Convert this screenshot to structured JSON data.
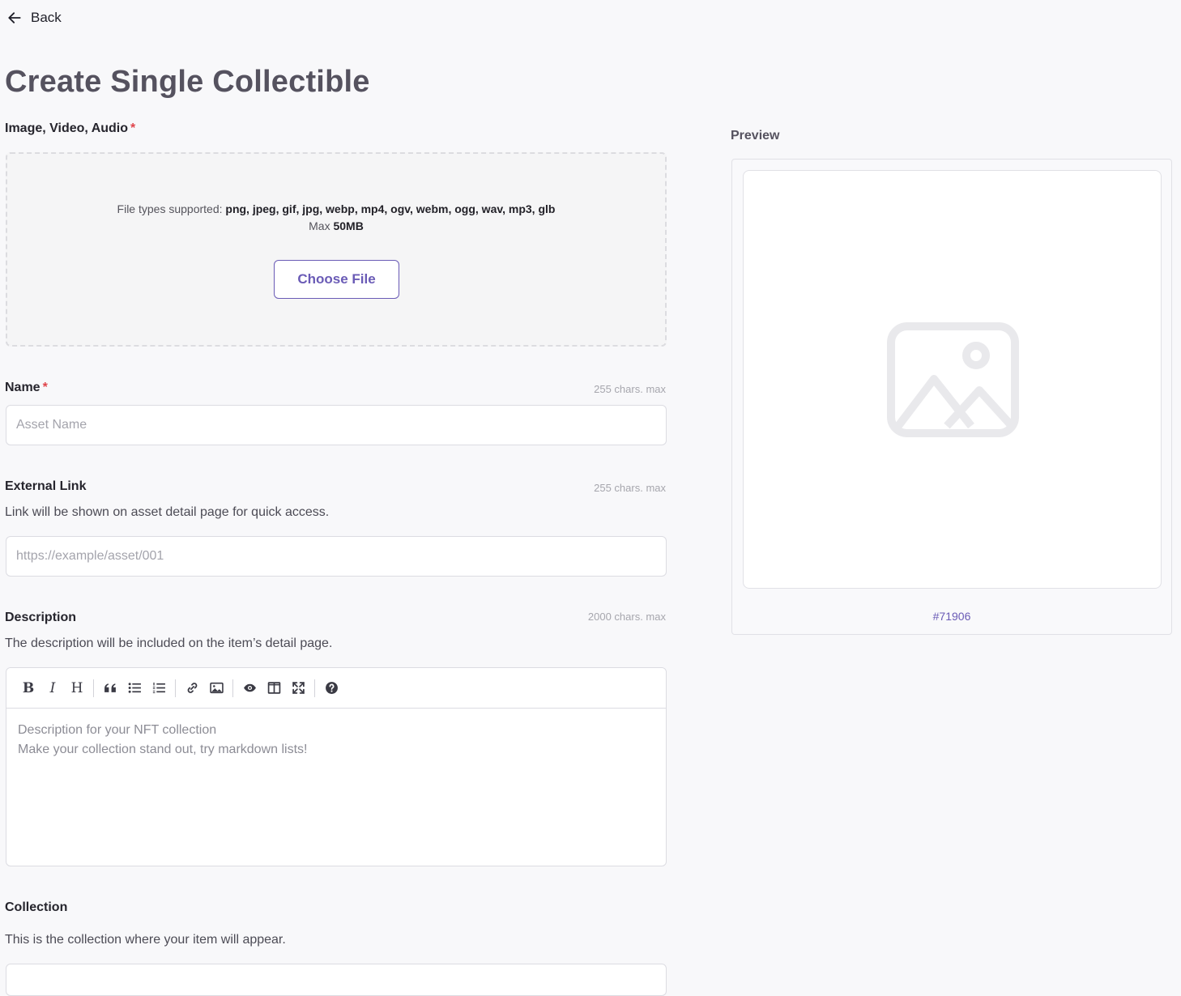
{
  "nav": {
    "back_label": "Back"
  },
  "page_title": "Create Single Collectible",
  "upload": {
    "label": "Image, Video, Audio",
    "required_mark": "*",
    "types_prefix": "File types supported: ",
    "types": "png, jpeg, gif, jpg, webp, mp4, ogv, webm, ogg, wav, mp3, glb",
    "max_prefix": "Max ",
    "max_size": "50MB",
    "choose_label": "Choose File"
  },
  "name": {
    "label": "Name",
    "required_mark": "*",
    "limit": "255 chars. max",
    "placeholder": "Asset Name",
    "value": ""
  },
  "external_link": {
    "label": "External Link",
    "limit": "255 chars. max",
    "help": "Link will be shown on asset detail page for quick access.",
    "placeholder": "https://example/asset/001",
    "value": ""
  },
  "description": {
    "label": "Description",
    "limit": "2000 chars. max",
    "help": "The description will be included on the item’s detail page.",
    "placeholder_line1": "Description for your NFT collection",
    "placeholder_line2": "Make your collection stand out, try markdown lists!",
    "toolbar": {
      "bold": "B",
      "italic": "I",
      "heading": "H"
    }
  },
  "collection": {
    "label": "Collection",
    "help": "This is the collection where your item will appear."
  },
  "preview": {
    "label": "Preview",
    "token_id": "#71906"
  },
  "colors": {
    "accent": "#6a5bb6",
    "required": "#e0444a",
    "background": "#f8f8fa"
  }
}
